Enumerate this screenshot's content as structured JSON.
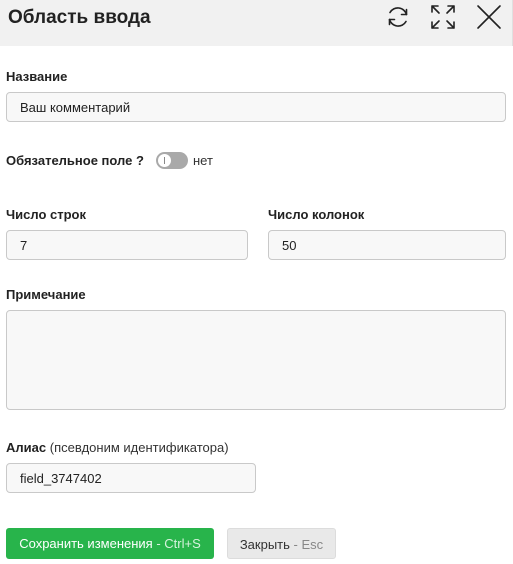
{
  "dialog": {
    "title": "Область ввода"
  },
  "header_icons": [
    "refresh-icon",
    "fullscreen-icon",
    "close-icon"
  ],
  "form": {
    "name": {
      "label": "Название",
      "value": "Ваш комментарий"
    },
    "required": {
      "label": "Обязательное поле ?",
      "state": "нет",
      "checked": false
    },
    "rows": {
      "label": "Число строк",
      "value": "7"
    },
    "cols": {
      "label": "Число колонок",
      "value": "50"
    },
    "note": {
      "label": "Примечание",
      "value": ""
    },
    "alias": {
      "label": "Алиас",
      "hint": "(псевдоним идентификатора)",
      "value": "field_3747402"
    }
  },
  "buttons": {
    "save": {
      "label": "Сохранить изменения",
      "shortcut": "- Ctrl+S"
    },
    "close": {
      "label": "Закрыть",
      "shortcut": "- Esc"
    }
  },
  "colors": {
    "save_button": "#28b44b",
    "header_bg": "#f1f1f1",
    "toggle_off": "#a9a9a9"
  }
}
